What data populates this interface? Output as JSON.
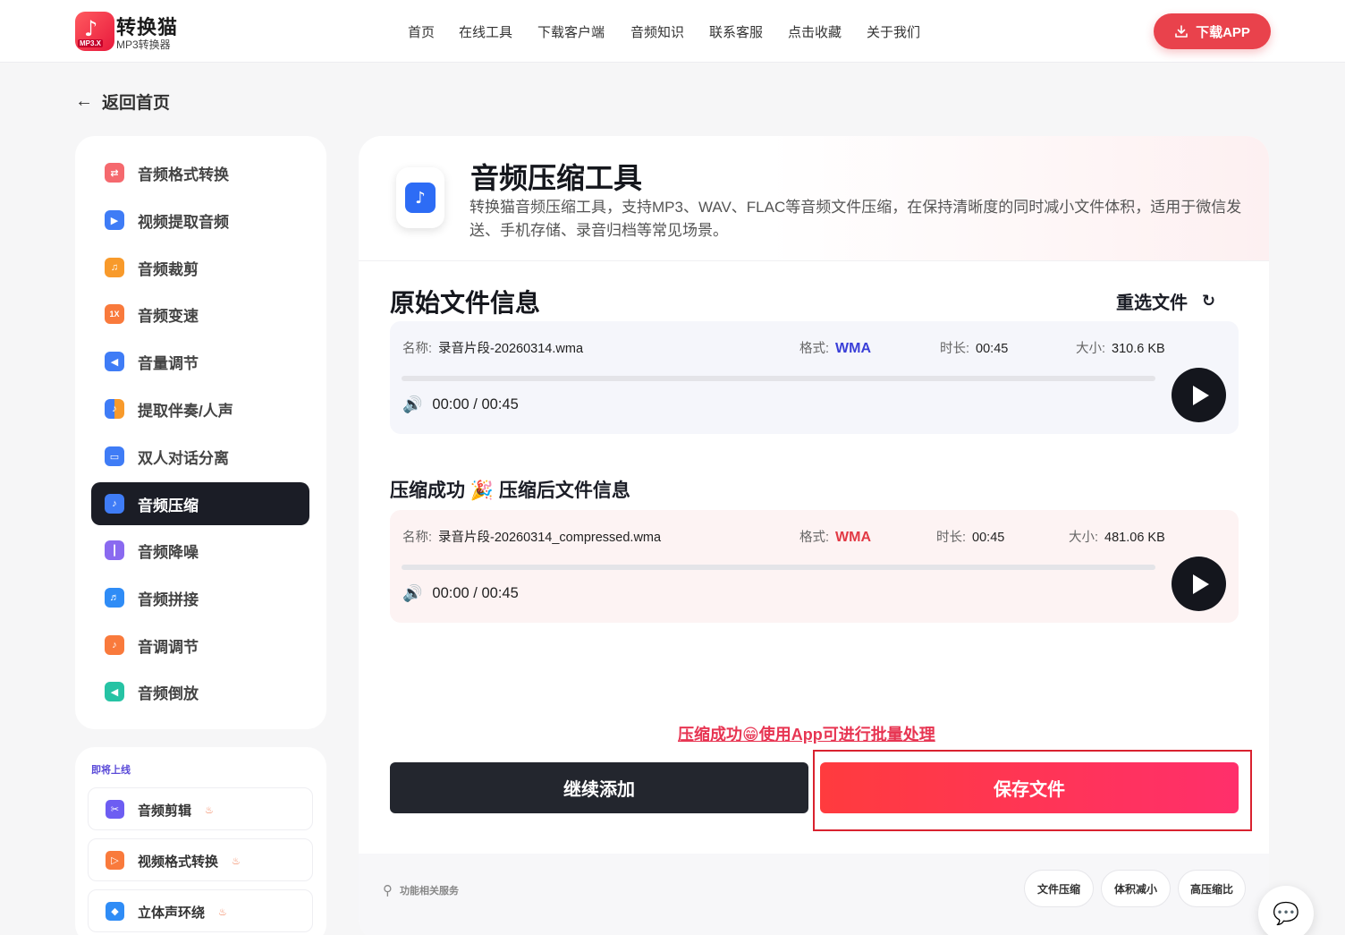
{
  "logo": {
    "title": "转换猫",
    "subtitle": "MP3转换器",
    "badge": "MP3.X"
  },
  "nav": {
    "items": [
      "首页",
      "在线工具",
      "下载客户端",
      "音频知识",
      "联系客服",
      "点击收藏",
      "关于我们"
    ],
    "download_app": "下载APP"
  },
  "back": {
    "label": "返回首页"
  },
  "sidebar": {
    "items": [
      {
        "label": "音频格式转换",
        "icon": "format-convert-icon",
        "color": "#f5696e"
      },
      {
        "label": "视频提取音频",
        "icon": "video-extract-icon",
        "color": "#3f7cf6"
      },
      {
        "label": "音频裁剪",
        "icon": "audio-cut-icon",
        "color": "#f89a2b"
      },
      {
        "label": "音频变速",
        "icon": "speed-icon",
        "color": "#f97a3c"
      },
      {
        "label": "音量调节",
        "icon": "volume-icon",
        "color": "#3f7cf6"
      },
      {
        "label": "提取伴奏/人声",
        "icon": "vocal-extract-icon",
        "color": "#3f7cf6"
      },
      {
        "label": "双人对话分离",
        "icon": "dialogue-split-icon",
        "color": "#3f7cf6"
      },
      {
        "label": "音频压缩",
        "icon": "audio-compress-icon",
        "color": "#3f7cf6"
      },
      {
        "label": "音频降噪",
        "icon": "denoise-icon",
        "color": "#8a6af0"
      },
      {
        "label": "音频拼接",
        "icon": "audio-join-icon",
        "color": "#2f8cf6"
      },
      {
        "label": "音调调节",
        "icon": "pitch-icon",
        "color": "#f97a3c"
      },
      {
        "label": "音频倒放",
        "icon": "reverse-icon",
        "color": "#26c3a4"
      }
    ],
    "active_index": 7
  },
  "coming_soon": {
    "title": "即将上线",
    "items": [
      {
        "label": "音频剪辑",
        "icon": "scissors-icon",
        "color": "#6d5df2"
      },
      {
        "label": "视频格式转换",
        "icon": "video-convert-icon",
        "color": "#f97a3c"
      },
      {
        "label": "立体声环绕",
        "icon": "cube-icon",
        "color": "#2f8cf6"
      }
    ],
    "hot_icon": "♨"
  },
  "tool": {
    "title": "音频压缩工具",
    "description": "转换猫音频压缩工具，支持MP3、WAV、FLAC等音频文件压缩，在保持清晰度的同时减小文件体积，适用于微信发送、手机存储、录音归档等常见场景。"
  },
  "original": {
    "section_title": "原始文件信息",
    "reselect": "重选文件",
    "name_label": "名称:",
    "name": "录音片段-20260314.wma",
    "format_label": "格式:",
    "format": "WMA",
    "format_color": "#3a3fd8",
    "duration_label": "时长:",
    "duration": "00:45",
    "size_label": "大小:",
    "size": "310.6 KB",
    "time": "00:00 / 00:45",
    "progress": 0
  },
  "compressed": {
    "section_title": "压缩成功 🎉 压缩后文件信息",
    "name_label": "名称:",
    "name": "录音片段-20260314_compressed.wma",
    "format_label": "格式:",
    "format": "WMA",
    "format_color": "#e23a45",
    "duration_label": "时长:",
    "duration": "00:45",
    "size_label": "大小:",
    "size": "481.06 KB",
    "time": "00:00 / 00:45",
    "progress": 0
  },
  "promo": "压缩成功😁使用App可进行批量处理",
  "actions": {
    "add": "继续添加",
    "save": "保存文件"
  },
  "services": {
    "label": "功能相关服务",
    "chips": [
      "文件压缩",
      "体积减小",
      "高压缩比"
    ]
  },
  "chat": {
    "icon": "chat-bubble-icon"
  }
}
